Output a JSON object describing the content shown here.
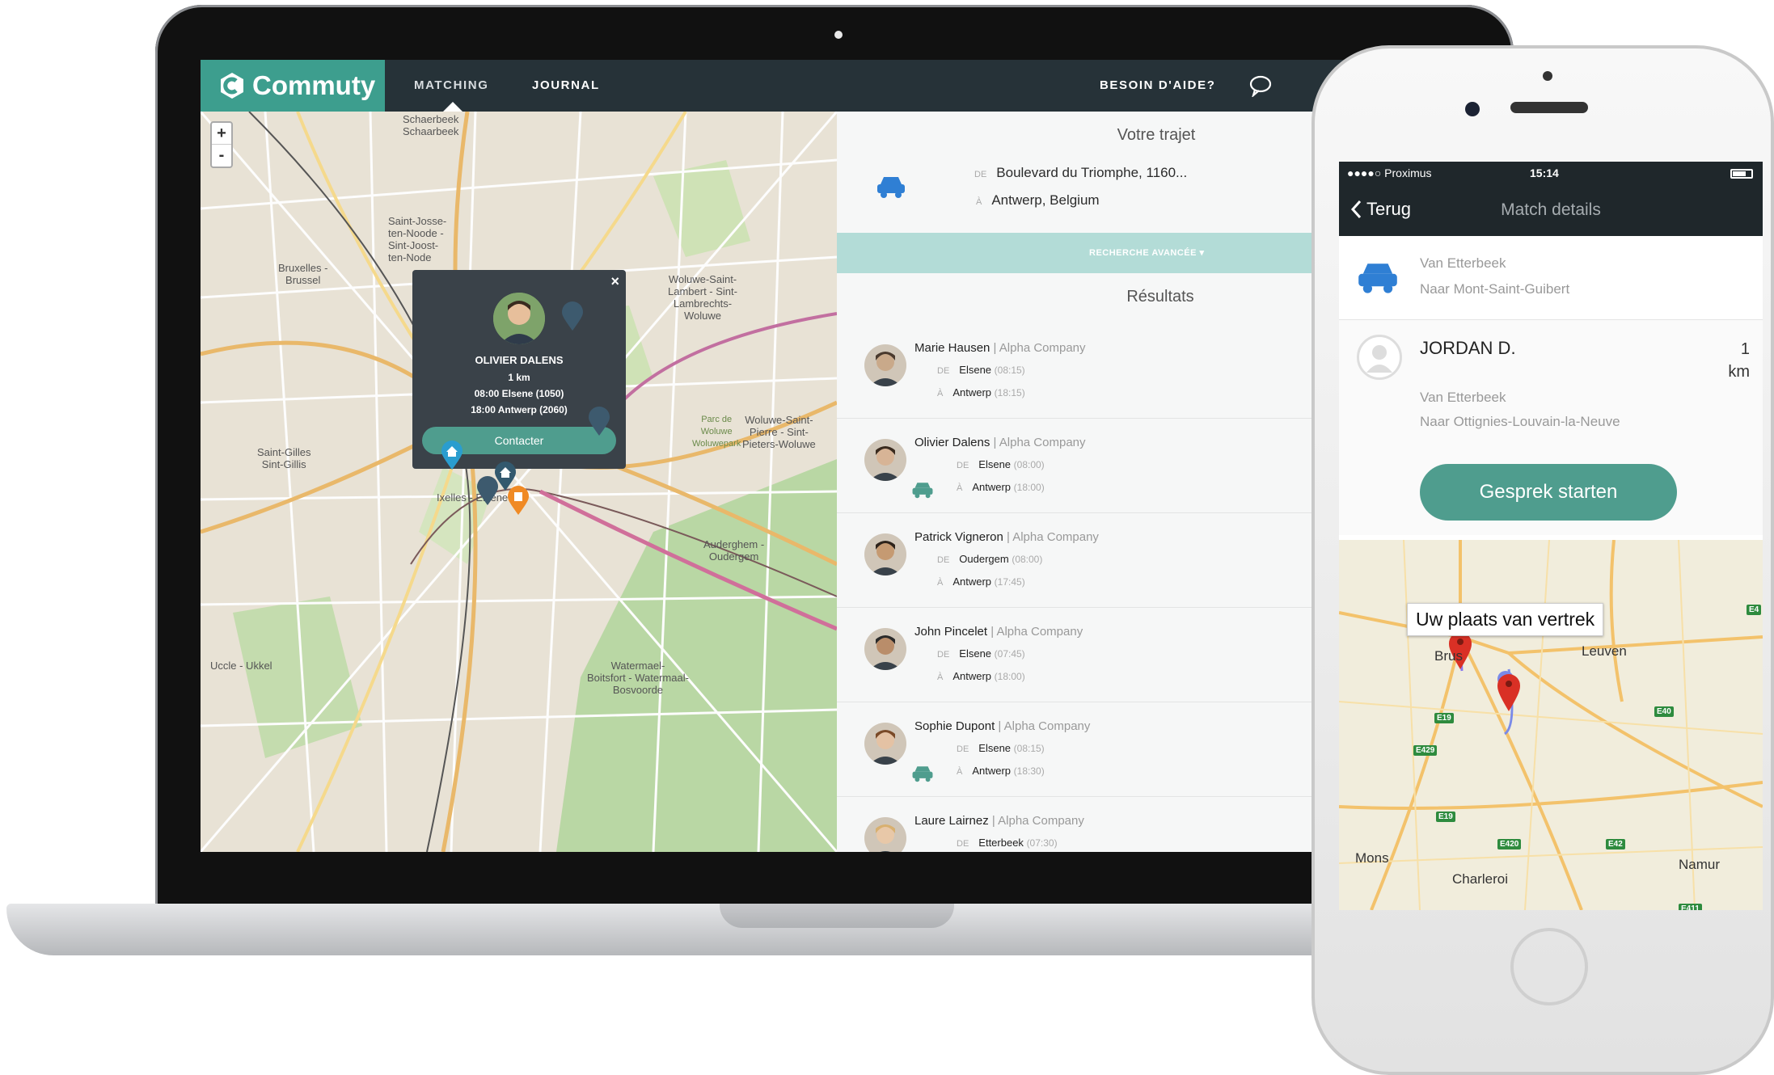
{
  "laptop": {
    "brand": "Commuty",
    "nav": {
      "matching": "MATCHING",
      "journal": "JOURNAL",
      "help": "BESOIN D'AIDE?"
    },
    "zoom": {
      "in": "+",
      "out": "-"
    },
    "map_labels": {
      "schaerbeek": "Schaerbeek\nSchaarbeek",
      "bruxelles": "Bruxelles -\nBrussel",
      "stjosse": "Saint-Josse-\nten-Noode -\nSint-Joost-\nten-Node",
      "woluwe_lambert": "Woluwe-Saint-\nLambert - Sint-\nLambrechts-\nWoluwe",
      "woluwe_pierre": "Woluwe-Saint-\nPierre - Sint-\nPieters-Woluwe",
      "saint_gilles": "Saint-Gilles\nSint-Gillis",
      "ixelles": "Ixelles - Elsene",
      "auderghem": "Auderghem -\nOudergem",
      "uccle": "Uccle - Ukkel",
      "watermael": "Watermael-\nBoitsfort - Watermaal-\nBosvoorde",
      "parc": "Parc de\nWoluwe\nWoluwepark"
    },
    "popup": {
      "name": "OLIVIER DALENS",
      "distance": "1 km",
      "from": "08:00 Elsene (1050)",
      "to": "18:00 Antwerp (2060)",
      "button": "Contacter"
    },
    "trajet": {
      "title": "Votre trajet",
      "from_tag": "DE",
      "from": "Boulevard du Triomphe, 1160...",
      "to_tag": "À",
      "to": "Antwerp, Belgium"
    },
    "advanced": "RECHERCHE AVANCÉE ▾",
    "results_title": "Résultats",
    "results": [
      {
        "name": "Marie Hausen",
        "company": " | Alpha Company",
        "from_tag": "DE",
        "from": "Elsene",
        "from_time": "(08:15)",
        "to_tag": "À",
        "to": "Antwerp",
        "to_time": "(18:15)"
      },
      {
        "name": "Olivier Dalens",
        "company": " | Alpha Company",
        "from_tag": "DE",
        "from": "Elsene",
        "from_time": "(08:00)",
        "to_tag": "À",
        "to": "Antwerp",
        "to_time": "(18:00)"
      },
      {
        "name": "Patrick Vigneron",
        "company": " | Alpha Company",
        "from_tag": "DE",
        "from": "Oudergem",
        "from_time": "(08:00)",
        "to_tag": "À",
        "to": "Antwerp",
        "to_time": "(17:45)"
      },
      {
        "name": "John Pincelet",
        "company": " | Alpha Company",
        "from_tag": "DE",
        "from": "Elsene",
        "from_time": "(07:45)",
        "to_tag": "À",
        "to": "Antwerp",
        "to_time": "(18:00)"
      },
      {
        "name": "Sophie Dupont",
        "company": " | Alpha Company",
        "from_tag": "DE",
        "from": "Elsene",
        "from_time": "(08:15)",
        "to_tag": "À",
        "to": "Antwerp",
        "to_time": "(18:30)"
      },
      {
        "name": "Laure Lairnez",
        "company": " | Alpha Company",
        "from_tag": "DE",
        "from": "Etterbeek",
        "from_time": "(07:30)",
        "to_tag": "",
        "to": "",
        "to_time": ""
      }
    ]
  },
  "phone": {
    "carrier": "●●●●○ Proximus",
    "time": "15:14",
    "back": "Terug",
    "title": "Match details",
    "trip": {
      "from": "Van Etterbeek",
      "to": "Naar Mont-Saint-Guibert"
    },
    "match": {
      "name": "JORDAN D.",
      "distance": "1\nkm",
      "from": "Van Etterbeek",
      "to": "Naar Ottignies-Louvain-la-Neuve",
      "button": "Gesprek starten"
    },
    "map": {
      "tooltip": "Uw plaats van vertrek",
      "brussels": "Brus",
      "leuven": "Leuven",
      "mons": "Mons",
      "charleroi": "Charleroi",
      "namur": "Namur",
      "roads": [
        "E19",
        "E40",
        "E429",
        "E19",
        "E420",
        "E42",
        "E411",
        "E4"
      ]
    }
  },
  "colors": {
    "brand_teal": "#3d9e8e",
    "button_teal": "#4f9d8e",
    "topbar_dark": "#263238",
    "accent_blue": "#2f7fd4",
    "pin_orange": "#f08a24",
    "pin_red": "#d93025"
  }
}
